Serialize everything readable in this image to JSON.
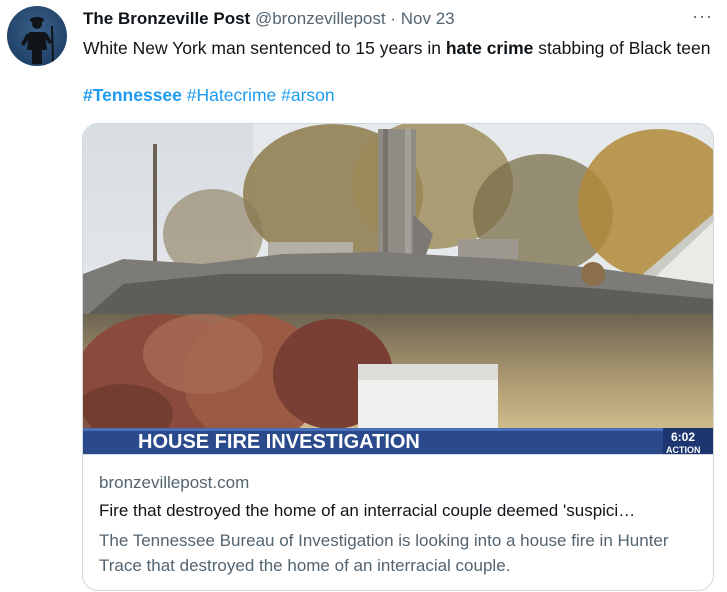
{
  "tweet": {
    "author_name": "The Bronzeville Post",
    "handle": "@bronzevillepost",
    "separator": "·",
    "date": "Nov 23",
    "more": "···",
    "text_before": "White New York man sentenced to 15 years in ",
    "text_bold": "hate crime",
    "text_after": " stabbing of Black teen",
    "hashtags": [
      "#Tennessee",
      "#Hatecrime",
      "#arson"
    ]
  },
  "card": {
    "banner_text": "HOUSE FIRE INVESTIGATION",
    "banner_time": "6:02",
    "banner_action": "ACTION",
    "domain": "bronzevillepost.com",
    "title": "Fire that destroyed the home of an interracial couple deemed 'suspici…",
    "description": "The Tennessee Bureau of Investigation is looking into a house fire in Hunter Trace that destroyed the home of an interracial couple."
  },
  "colors": {
    "link": "#1d9bf0",
    "secondary": "#536471",
    "banner_blue": "#2a4a8c"
  }
}
